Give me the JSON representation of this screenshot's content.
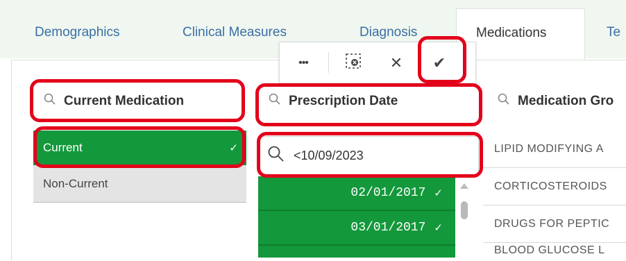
{
  "tabs": [
    {
      "label": "Demographics"
    },
    {
      "label": "Clinical Measures"
    },
    {
      "label": "Diagnosis"
    },
    {
      "label": "Medications"
    },
    {
      "label": "Te"
    }
  ],
  "toolbar": {
    "more_label": "•••",
    "clear_label": "✕",
    "confirm_label": "✔"
  },
  "columns": {
    "current_medication": {
      "title": "Current Medication",
      "items": [
        {
          "label": "Current",
          "selected": true
        },
        {
          "label": "Non-Current",
          "selected": false
        }
      ]
    },
    "prescription_date": {
      "title": "Prescription Date",
      "search_value": "<10/09/2023",
      "items": [
        {
          "label": "02/01/2017"
        },
        {
          "label": "03/01/2017"
        }
      ]
    },
    "medication_group": {
      "title": "Medication Gro",
      "items": [
        {
          "label": "LIPID MODIFYING A"
        },
        {
          "label": "CORTICOSTEROIDS"
        },
        {
          "label": "DRUGS FOR PEPTIC"
        },
        {
          "label": "BLOOD GLUCOSE L"
        }
      ]
    }
  },
  "check_glyph": "✓",
  "colors": {
    "selected_green": "#13983b",
    "annotation_red": "#e3001b",
    "tab_link": "#3a6ea5"
  }
}
